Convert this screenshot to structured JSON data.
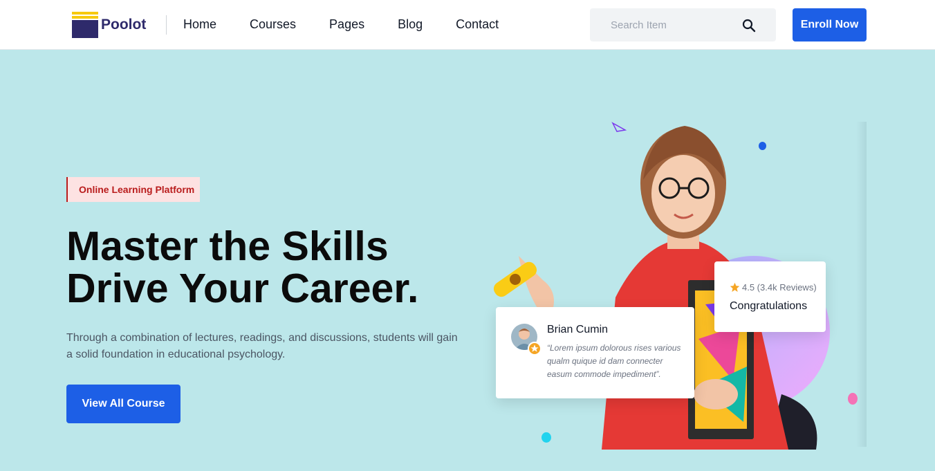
{
  "brand": {
    "name": "Poolot"
  },
  "nav": [
    {
      "label": "Home"
    },
    {
      "label": "Courses"
    },
    {
      "label": "Pages"
    },
    {
      "label": "Blog"
    },
    {
      "label": "Contact"
    }
  ],
  "search": {
    "placeholder": "Search Item",
    "value": ""
  },
  "header": {
    "enroll_label": "Enroll Now"
  },
  "hero": {
    "badge": "Online Learning Platform",
    "title_line1": "Master the Skills",
    "title_line2": "Drive Your Career.",
    "description": "Through a combination of lectures, readings, and discussions, students will gain a solid foundation in educational psychology.",
    "cta_label": "View All Course"
  },
  "review_card": {
    "name": "Brian Cumin",
    "text": "“Lorem ipsum dolorous rises various qualm quique id dam connecter easum commode impediment”."
  },
  "rating_card": {
    "rating": "4.5 (3.4k Reviews)",
    "title": "Congratulations"
  },
  "colors": {
    "hero_bg": "#bce7ea",
    "primary": "#1d5fe6",
    "brand": "#2e2a6b",
    "badge_text": "#b91c1c",
    "star": "#f5a524"
  },
  "icons": [
    "search-icon",
    "star-icon"
  ]
}
